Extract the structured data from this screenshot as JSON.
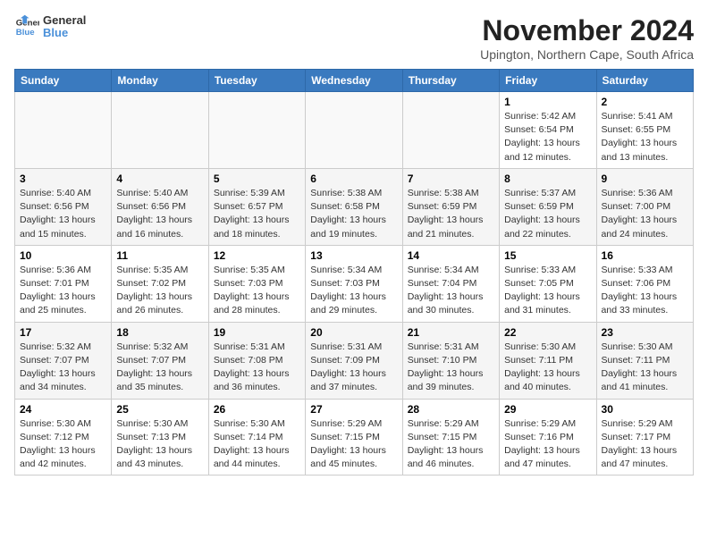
{
  "header": {
    "logo_line1": "General",
    "logo_line2": "Blue",
    "month_year": "November 2024",
    "location": "Upington, Northern Cape, South Africa"
  },
  "days_of_week": [
    "Sunday",
    "Monday",
    "Tuesday",
    "Wednesday",
    "Thursday",
    "Friday",
    "Saturday"
  ],
  "weeks": [
    [
      {
        "day": "",
        "info": ""
      },
      {
        "day": "",
        "info": ""
      },
      {
        "day": "",
        "info": ""
      },
      {
        "day": "",
        "info": ""
      },
      {
        "day": "",
        "info": ""
      },
      {
        "day": "1",
        "info": "Sunrise: 5:42 AM\nSunset: 6:54 PM\nDaylight: 13 hours and 12 minutes."
      },
      {
        "day": "2",
        "info": "Sunrise: 5:41 AM\nSunset: 6:55 PM\nDaylight: 13 hours and 13 minutes."
      }
    ],
    [
      {
        "day": "3",
        "info": "Sunrise: 5:40 AM\nSunset: 6:56 PM\nDaylight: 13 hours and 15 minutes."
      },
      {
        "day": "4",
        "info": "Sunrise: 5:40 AM\nSunset: 6:56 PM\nDaylight: 13 hours and 16 minutes."
      },
      {
        "day": "5",
        "info": "Sunrise: 5:39 AM\nSunset: 6:57 PM\nDaylight: 13 hours and 18 minutes."
      },
      {
        "day": "6",
        "info": "Sunrise: 5:38 AM\nSunset: 6:58 PM\nDaylight: 13 hours and 19 minutes."
      },
      {
        "day": "7",
        "info": "Sunrise: 5:38 AM\nSunset: 6:59 PM\nDaylight: 13 hours and 21 minutes."
      },
      {
        "day": "8",
        "info": "Sunrise: 5:37 AM\nSunset: 6:59 PM\nDaylight: 13 hours and 22 minutes."
      },
      {
        "day": "9",
        "info": "Sunrise: 5:36 AM\nSunset: 7:00 PM\nDaylight: 13 hours and 24 minutes."
      }
    ],
    [
      {
        "day": "10",
        "info": "Sunrise: 5:36 AM\nSunset: 7:01 PM\nDaylight: 13 hours and 25 minutes."
      },
      {
        "day": "11",
        "info": "Sunrise: 5:35 AM\nSunset: 7:02 PM\nDaylight: 13 hours and 26 minutes."
      },
      {
        "day": "12",
        "info": "Sunrise: 5:35 AM\nSunset: 7:03 PM\nDaylight: 13 hours and 28 minutes."
      },
      {
        "day": "13",
        "info": "Sunrise: 5:34 AM\nSunset: 7:03 PM\nDaylight: 13 hours and 29 minutes."
      },
      {
        "day": "14",
        "info": "Sunrise: 5:34 AM\nSunset: 7:04 PM\nDaylight: 13 hours and 30 minutes."
      },
      {
        "day": "15",
        "info": "Sunrise: 5:33 AM\nSunset: 7:05 PM\nDaylight: 13 hours and 31 minutes."
      },
      {
        "day": "16",
        "info": "Sunrise: 5:33 AM\nSunset: 7:06 PM\nDaylight: 13 hours and 33 minutes."
      }
    ],
    [
      {
        "day": "17",
        "info": "Sunrise: 5:32 AM\nSunset: 7:07 PM\nDaylight: 13 hours and 34 minutes."
      },
      {
        "day": "18",
        "info": "Sunrise: 5:32 AM\nSunset: 7:07 PM\nDaylight: 13 hours and 35 minutes."
      },
      {
        "day": "19",
        "info": "Sunrise: 5:31 AM\nSunset: 7:08 PM\nDaylight: 13 hours and 36 minutes."
      },
      {
        "day": "20",
        "info": "Sunrise: 5:31 AM\nSunset: 7:09 PM\nDaylight: 13 hours and 37 minutes."
      },
      {
        "day": "21",
        "info": "Sunrise: 5:31 AM\nSunset: 7:10 PM\nDaylight: 13 hours and 39 minutes."
      },
      {
        "day": "22",
        "info": "Sunrise: 5:30 AM\nSunset: 7:11 PM\nDaylight: 13 hours and 40 minutes."
      },
      {
        "day": "23",
        "info": "Sunrise: 5:30 AM\nSunset: 7:11 PM\nDaylight: 13 hours and 41 minutes."
      }
    ],
    [
      {
        "day": "24",
        "info": "Sunrise: 5:30 AM\nSunset: 7:12 PM\nDaylight: 13 hours and 42 minutes."
      },
      {
        "day": "25",
        "info": "Sunrise: 5:30 AM\nSunset: 7:13 PM\nDaylight: 13 hours and 43 minutes."
      },
      {
        "day": "26",
        "info": "Sunrise: 5:30 AM\nSunset: 7:14 PM\nDaylight: 13 hours and 44 minutes."
      },
      {
        "day": "27",
        "info": "Sunrise: 5:29 AM\nSunset: 7:15 PM\nDaylight: 13 hours and 45 minutes."
      },
      {
        "day": "28",
        "info": "Sunrise: 5:29 AM\nSunset: 7:15 PM\nDaylight: 13 hours and 46 minutes."
      },
      {
        "day": "29",
        "info": "Sunrise: 5:29 AM\nSunset: 7:16 PM\nDaylight: 13 hours and 47 minutes."
      },
      {
        "day": "30",
        "info": "Sunrise: 5:29 AM\nSunset: 7:17 PM\nDaylight: 13 hours and 47 minutes."
      }
    ]
  ]
}
